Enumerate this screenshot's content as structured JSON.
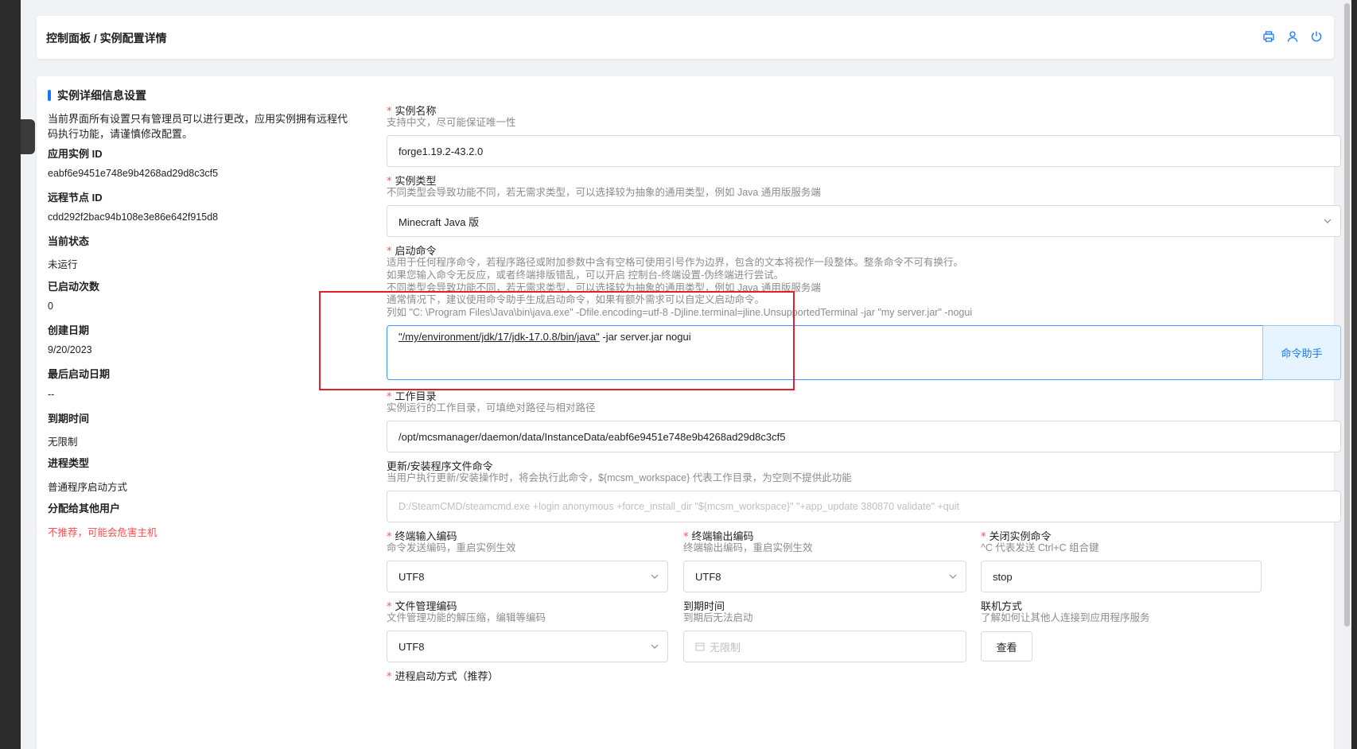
{
  "header": {
    "breadcrumb": "控制面板 / 实例配置详情",
    "icons": [
      "printer-icon",
      "user-icon",
      "power-icon"
    ]
  },
  "card": {
    "title": "实例详细信息设置"
  },
  "left": {
    "warning": "当前界面所有设置只有管理员可以进行更改，应用实例拥有远程代码执行功能，请谨慎修改配置。",
    "items": [
      {
        "label": "应用实例 ID",
        "value": "eabf6e9451e748e9b4268ad29d8c3cf5"
      },
      {
        "label": "远程节点 ID",
        "value": "cdd292f2bac94b108e3e86e642f915d8"
      },
      {
        "label": "当前状态",
        "value": "未运行"
      },
      {
        "label": "已启动次数",
        "value": "0"
      },
      {
        "label": "创建日期",
        "value": "9/20/2023"
      },
      {
        "label": "最后启动日期",
        "value": "--"
      },
      {
        "label": "到期时间",
        "value": "无限制"
      },
      {
        "label": "进程类型",
        "value": "普通程序启动方式"
      },
      {
        "label": "分配给其他用户",
        "value": "不推荐，可能会危害主机"
      }
    ]
  },
  "form": {
    "name": {
      "label": "实例名称",
      "desc": "支持中文，尽可能保证唯一性",
      "value": "forge1.19.2-43.2.0"
    },
    "type": {
      "label": "实例类型",
      "desc": "不同类型会导致功能不同，若无需求类型，可以选择较为抽象的通用类型，例如 Java 通用版服务端",
      "value": "Minecraft Java 版"
    },
    "start_cmd": {
      "label": "启动命令",
      "desc": [
        "适用于任何程序命令，若程序路径或附加参数中含有空格可使用引号作为边界，包含的文本将视作一段整体。整条命令不可有换行。",
        "如果您输入命令无反应，或者终端排版错乱，可以开启 控制台-终端设置-伪终端进行尝试。",
        "不同类型会导致功能不同，若无需求类型，可以选择较为抽象的通用类型，例如 Java 通用版服务端",
        "通常情况下，建议使用命令助手生成启动命令，如果有额外需求可以自定义启动命令。",
        "列如 \"C: \\Program Files\\Java\\bin\\java.exe\" -Dfile.encoding=utf-8 -Djline.terminal=jline.UnsupportedTerminal -jar \"my server.jar\" -nogui"
      ],
      "value_part1": "\"/my/environment/jdk/17/jdk-17.0.8/bin/java\"",
      "value_part2": " -jar server.jar nogui",
      "helper_label": "命令助手"
    },
    "cwd": {
      "label": "工作目录",
      "desc": "实例运行的工作目录，可填绝对路径与相对路径",
      "value": "/opt/mcsmanager/daemon/data/InstanceData/eabf6e9451e748e9b4268ad29d8c3cf5"
    },
    "update_cmd": {
      "label": "更新/安装程序文件命令",
      "desc": "当用户执行更新/安装操作时，将会执行此命令，${mcsm_workspace} 代表工作目录，为空则不提供此功能",
      "placeholder": "D:/SteamCMD/steamcmd.exe +login anonymous +force_install_dir \"${mcsm_workspace}\" \"+app_update 380870 validate\" +quit"
    },
    "in_enc": {
      "label": "终端输入编码",
      "desc": "命令发送编码，重启实例生效",
      "value": "UTF8"
    },
    "out_enc": {
      "label": "终端输出编码",
      "desc": "终端输出编码，重启实例生效",
      "value": "UTF8"
    },
    "stop_cmd": {
      "label": "关闭实例命令",
      "desc": "^C 代表发送 Ctrl+C 组合键",
      "value": "stop"
    },
    "file_enc": {
      "label": "文件管理编码",
      "desc": "文件管理功能的解压缩，编辑等编码",
      "value": "UTF8"
    },
    "expire": {
      "label": "到期时间",
      "desc": "到期后无法启动",
      "placeholder": "无限制"
    },
    "connect": {
      "label": "联机方式",
      "desc": "了解如何让其他人连接到应用程序服务",
      "button": "查看"
    },
    "proc_mode": {
      "label": "进程启动方式（推荐）"
    }
  },
  "colors": {
    "accent": "#1677ff",
    "required": "#ff4d4f",
    "highlight_box": "#e0202b"
  }
}
